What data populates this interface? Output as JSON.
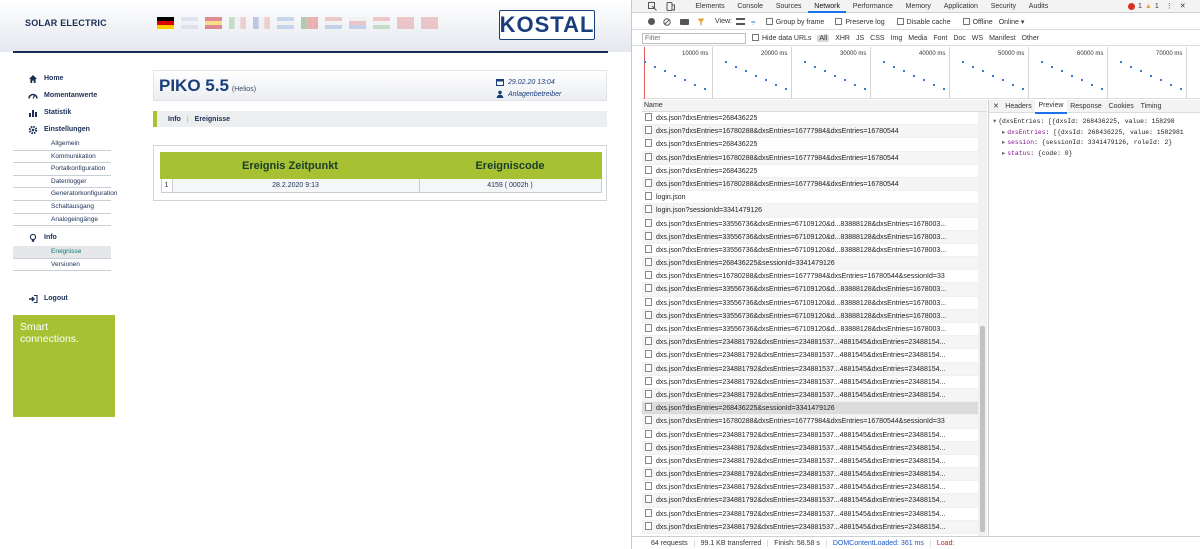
{
  "kostal": {
    "brand": "SOLAR ELECTRIC",
    "logo": "KOSTAL",
    "flags": [
      "de",
      "en",
      "es",
      "it",
      "fr",
      "gr",
      "pt",
      "nl",
      "cz",
      "hu",
      "tr",
      "dk"
    ],
    "nav": [
      {
        "label": "Home",
        "icon": "home-icon"
      },
      {
        "label": "Momentanwerte",
        "icon": "gauge-icon"
      },
      {
        "label": "Statistik",
        "icon": "chart-icon"
      },
      {
        "label": "Einstellungen",
        "icon": "gear-icon"
      }
    ],
    "settings_sub": [
      "Allgemein",
      "Kommunikation",
      "Portalkonfiguration",
      "Datenlogger",
      "Generatorkonfiguration",
      "Schaltausgang",
      "Analogeingänge"
    ],
    "info_label": "Info",
    "info_sub": [
      "Ereignisse",
      "Versionen"
    ],
    "logout": "Logout",
    "smart_line1": "Smart",
    "smart_line2": "connections.",
    "device_name": "PIKO 5.5",
    "device_sub": "(Helios)",
    "datetime": "29.02.20 13:04",
    "user": "Anlagenbetreiber",
    "tab_info": "Info",
    "tab_events": "Ereignisse",
    "events": {
      "headers": [
        "Ereignis Zeitpunkt",
        "Ereigniscode"
      ],
      "rows": [
        {
          "idx": "1",
          "time": "28.2.2020 9:13",
          "code": "4159 ( 0002h )"
        }
      ]
    }
  },
  "devtools": {
    "panel_tabs": [
      "Elements",
      "Console",
      "Sources",
      "Network",
      "Performance",
      "Memory",
      "Application",
      "Security",
      "Audits"
    ],
    "errors": "1",
    "warnings": "1",
    "view_label": "View:",
    "group_by_frame": "Group by frame",
    "preserve_log": "Preserve log",
    "disable_cache": "Disable cache",
    "offline": "Offline",
    "online": "Online",
    "filter_placeholder": "Filter",
    "hide_data_urls": "Hide data URLs",
    "filter_types": [
      "All",
      "XHR",
      "JS",
      "CSS",
      "Img",
      "Media",
      "Font",
      "Doc",
      "WS",
      "Manifest",
      "Other"
    ],
    "timeline_labels": [
      "10000 ms",
      "20000 ms",
      "30000 ms",
      "40000 ms",
      "50000 ms",
      "60000 ms",
      "70000 ms"
    ],
    "name_col": "Name",
    "requests": [
      "dxs.json?dxsEntries=268436225",
      "dxs.json?dxsEntries=16780288&dxsEntries=16777984&dxsEntries=16780544",
      "dxs.json?dxsEntries=268436225",
      "dxs.json?dxsEntries=16780288&dxsEntries=16777984&dxsEntries=16780544",
      "dxs.json?dxsEntries=268436225",
      "dxs.json?dxsEntries=16780288&dxsEntries=16777984&dxsEntries=16780544",
      "login.json",
      "login.json?sessionId=3341479126",
      "dxs.json?dxsEntries=33556736&dxsEntries=67109120&d...83888128&dxsEntries=1678003...",
      "dxs.json?dxsEntries=33556736&dxsEntries=67109120&d...83888128&dxsEntries=1678003...",
      "dxs.json?dxsEntries=33556736&dxsEntries=67109120&d...83888128&dxsEntries=1678003...",
      "dxs.json?dxsEntries=268436225&sessionId=3341479126",
      "dxs.json?dxsEntries=16780288&dxsEntries=16777984&dxsEntries=16780544&sessionId=33",
      "dxs.json?dxsEntries=33556736&dxsEntries=67109120&d...83888128&dxsEntries=1678003...",
      "dxs.json?dxsEntries=33556736&dxsEntries=67109120&d...83888128&dxsEntries=1678003...",
      "dxs.json?dxsEntries=33556736&dxsEntries=67109120&d...83888128&dxsEntries=1678003...",
      "dxs.json?dxsEntries=33556736&dxsEntries=67109120&d...83888128&dxsEntries=1678003...",
      "dxs.json?dxsEntries=234881792&dxsEntries=234881537...4881545&dxsEntries=23488154...",
      "dxs.json?dxsEntries=234881792&dxsEntries=234881537...4881545&dxsEntries=23488154...",
      "dxs.json?dxsEntries=234881792&dxsEntries=234881537...4881545&dxsEntries=23488154...",
      "dxs.json?dxsEntries=234881792&dxsEntries=234881537...4881545&dxsEntries=23488154...",
      "dxs.json?dxsEntries=234881792&dxsEntries=234881537...4881545&dxsEntries=23488154...",
      "dxs.json?dxsEntries=268436225&sessionId=3341479126",
      "dxs.json?dxsEntries=16780288&dxsEntries=16777984&dxsEntries=16780544&sessionId=33",
      "dxs.json?dxsEntries=234881792&dxsEntries=234881537...4881545&dxsEntries=23488154...",
      "dxs.json?dxsEntries=234881792&dxsEntries=234881537...4881545&dxsEntries=23488154...",
      "dxs.json?dxsEntries=234881792&dxsEntries=234881537...4881545&dxsEntries=23488154...",
      "dxs.json?dxsEntries=234881792&dxsEntries=234881537...4881545&dxsEntries=23488154...",
      "dxs.json?dxsEntries=234881792&dxsEntries=234881537...4881545&dxsEntries=23488154...",
      "dxs.json?dxsEntries=234881792&dxsEntries=234881537...4881545&dxsEntries=23488154...",
      "dxs.json?dxsEntries=234881792&dxsEntries=234881537...4881545&dxsEntries=23488154...",
      "dxs.json?dxsEntries=234881792&dxsEntries=234881537...4881545&dxsEntries=23488154..."
    ],
    "selected_request_index": 22,
    "detail_tabs": [
      "Headers",
      "Preview",
      "Response",
      "Cookies",
      "Timing"
    ],
    "preview": {
      "line1": "{dxsEntries: [{dxsId: 268436225, value: 158298",
      "line2_key": "dxsEntries",
      "line2_val": ": [{dxsId: 268436225, value: 1582981",
      "line3_key": "session",
      "line3_val": ": {sessionId: 3341479126, roleId: 2}",
      "line4_key": "status",
      "line4_val": ": {code: 0}"
    },
    "status": {
      "requests": "64 requests",
      "transferred": "99.1 KB transferred",
      "finish": "Finish: 58.58 s",
      "domcontent": "DOMContentLoaded: 361 ms",
      "load": "Load:"
    }
  }
}
